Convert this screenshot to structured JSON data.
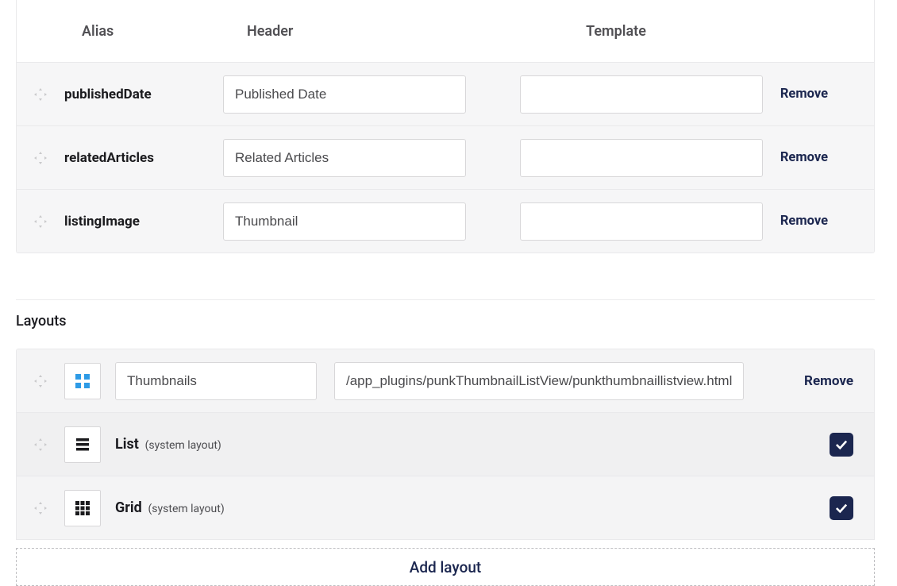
{
  "columns": {
    "headers": {
      "alias": "Alias",
      "header": "Header",
      "template": "Template"
    },
    "remove_label": "Remove",
    "rows": [
      {
        "alias": "publishedDate",
        "header": "Published Date",
        "template": ""
      },
      {
        "alias": "relatedArticles",
        "header": "Related Articles",
        "template": ""
      },
      {
        "alias": "listingImage",
        "header": "Thumbnail",
        "template": ""
      }
    ]
  },
  "layouts": {
    "title": "Layouts",
    "remove_label": "Remove",
    "system_tag": "(system layout)",
    "add_label": "Add layout",
    "custom": [
      {
        "icon": "thumbnails",
        "name": "Thumbnails",
        "path": "/app_plugins/punkThumbnailListView/punkthumbnaillistview.html"
      }
    ],
    "system": [
      {
        "icon": "list",
        "name": "List",
        "checked": true
      },
      {
        "icon": "grid",
        "name": "Grid",
        "checked": true
      }
    ]
  }
}
